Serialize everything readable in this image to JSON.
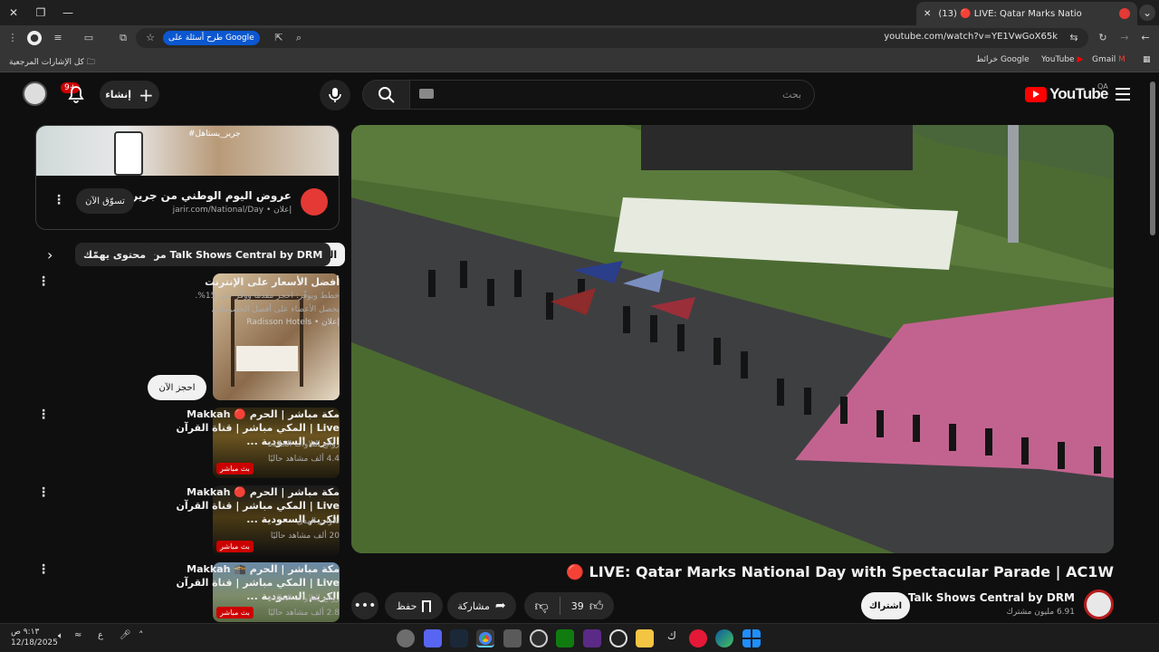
{
  "browser": {
    "tab_title": "(13) 🔴 LIVE: Qatar Marks Natio",
    "url": "youtube.com/watch?v=YE1VwGoX65k",
    "ask_google": "طرح أسئلة على Google",
    "bookmarks": {
      "all_bookmarks": "كل الإشارات المرجعية",
      "gmail": "Gmail",
      "youtube": "YouTube",
      "maps": "خرائط Google"
    }
  },
  "youtube_header": {
    "search_placeholder": "بحث",
    "create_label": "إنشاء",
    "notification_count": "9+",
    "logo_text": "YouTube",
    "country_code": "QA"
  },
  "ad": {
    "title": "عروض اليوم الوطني من جرير",
    "sponsor_line": "إعلان • jarir.com/National/Day",
    "button": "تسوّق الآن",
    "banner_tag": "#جرير_يستاهل"
  },
  "chips": {
    "all": "الكلّ",
    "from_channel": "من Talk Shows Central by DRM",
    "related": "محتوى يهمّك"
  },
  "hotel_ad": {
    "title": "أفضل الأسعار على الإنترنت",
    "description": "خطط وبوفّر: احجز مقدمًا ووفّر حتى 15%. يحصل الأعضاء على أفضل الخصومات.",
    "sponsor": "إعلان • Radisson Hotels",
    "button": "احجز الآن"
  },
  "related_videos": [
    {
      "title": "مكة مباشر | الحرم 🔴 Makkah Live | المكي مباشر | قناة القرآن الكريم السعودية ...",
      "channel": "روائع التلاوات الخالدة",
      "views": "4.4 ألف مشاهد حاليًا",
      "live": "بث مباشر"
    },
    {
      "title": "مكة مباشر | الحرم 🔴 Makkah Live | المكي مباشر | قناة القرآن الكريم السعودية ...",
      "channel": "تلاوات الهدى",
      "views": "20 ألف مشاهد حاليًا",
      "live": "بث مباشر"
    },
    {
      "title": "مكة مباشر | الحرم 🕋 Makkah Live | المكي مباشر | قناة القرآن الكريم السعودية ...",
      "channel": "روائع التلاوات الخالدة",
      "views": "2.8 ألف مشاهد حاليًا",
      "live": "بث مباشر"
    }
  ],
  "video": {
    "title": "🔴 LIVE: Qatar Marks National Day with Spectacular Parade | AC1W",
    "channel": "Talk Shows Central by DRM",
    "subscribers": "6.91 مليون مشترك",
    "subscribe": "اشتراك",
    "likes": "39",
    "share": "مشاركة",
    "save": "حفظ"
  },
  "taskbar": {
    "time": "٩:١٣ ص",
    "date": "12/18/2025",
    "lang": "ع"
  },
  "colors": {
    "yt_red": "#ff0000",
    "live_red": "#cc0000",
    "chrome_blue": "#0b57d0"
  }
}
